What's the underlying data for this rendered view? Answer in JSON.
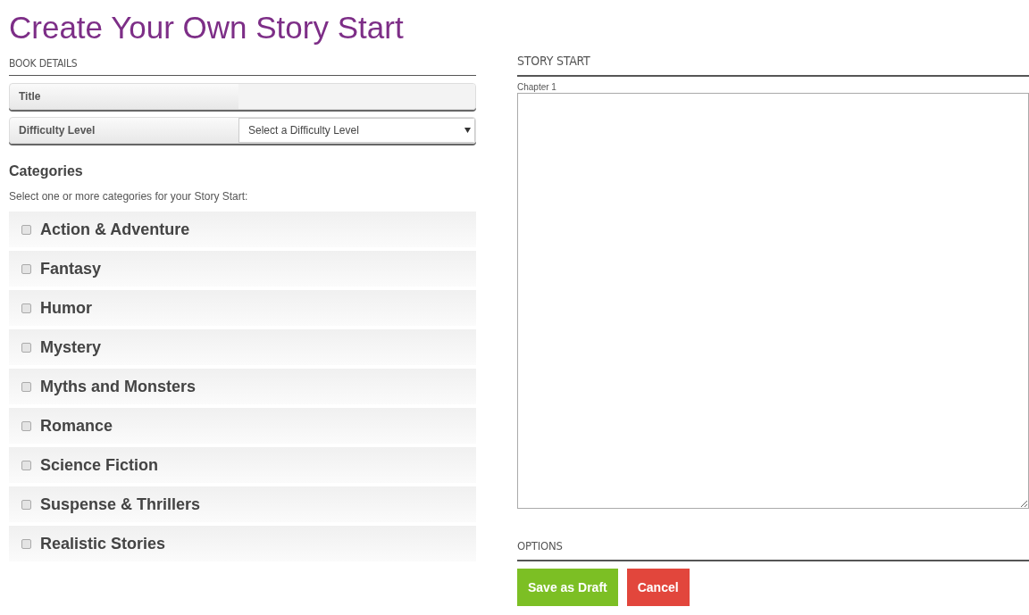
{
  "page_title": "Create Your Own Story Start",
  "book_details": {
    "heading": "BOOK DETAILS",
    "fields": [
      {
        "kind": "text",
        "label": "Title"
      },
      {
        "kind": "select",
        "label": "Difficulty Level",
        "placeholder": "Select a Difficulty Level"
      }
    ]
  },
  "categories": {
    "heading": "Categories",
    "hint": "Select one or more categories for your Story Start:",
    "items": [
      {
        "label": "Action & Adventure",
        "checked": false
      },
      {
        "label": "Fantasy",
        "checked": false
      },
      {
        "label": "Humor",
        "checked": false
      },
      {
        "label": "Mystery",
        "checked": false
      },
      {
        "label": "Myths and Monsters",
        "checked": false
      },
      {
        "label": "Romance",
        "checked": false
      },
      {
        "label": "Science Fiction",
        "checked": false
      },
      {
        "label": "Suspense & Thrillers",
        "checked": false
      },
      {
        "label": "Realistic Stories",
        "checked": false
      }
    ]
  },
  "story_start": {
    "heading": "STORY START",
    "chapter_label": "Chapter 1"
  },
  "options": {
    "heading": "OPTIONS",
    "buttons": [
      {
        "kind": "primary",
        "label": "Save as Draft"
      },
      {
        "kind": "danger",
        "label": "Cancel"
      }
    ]
  }
}
